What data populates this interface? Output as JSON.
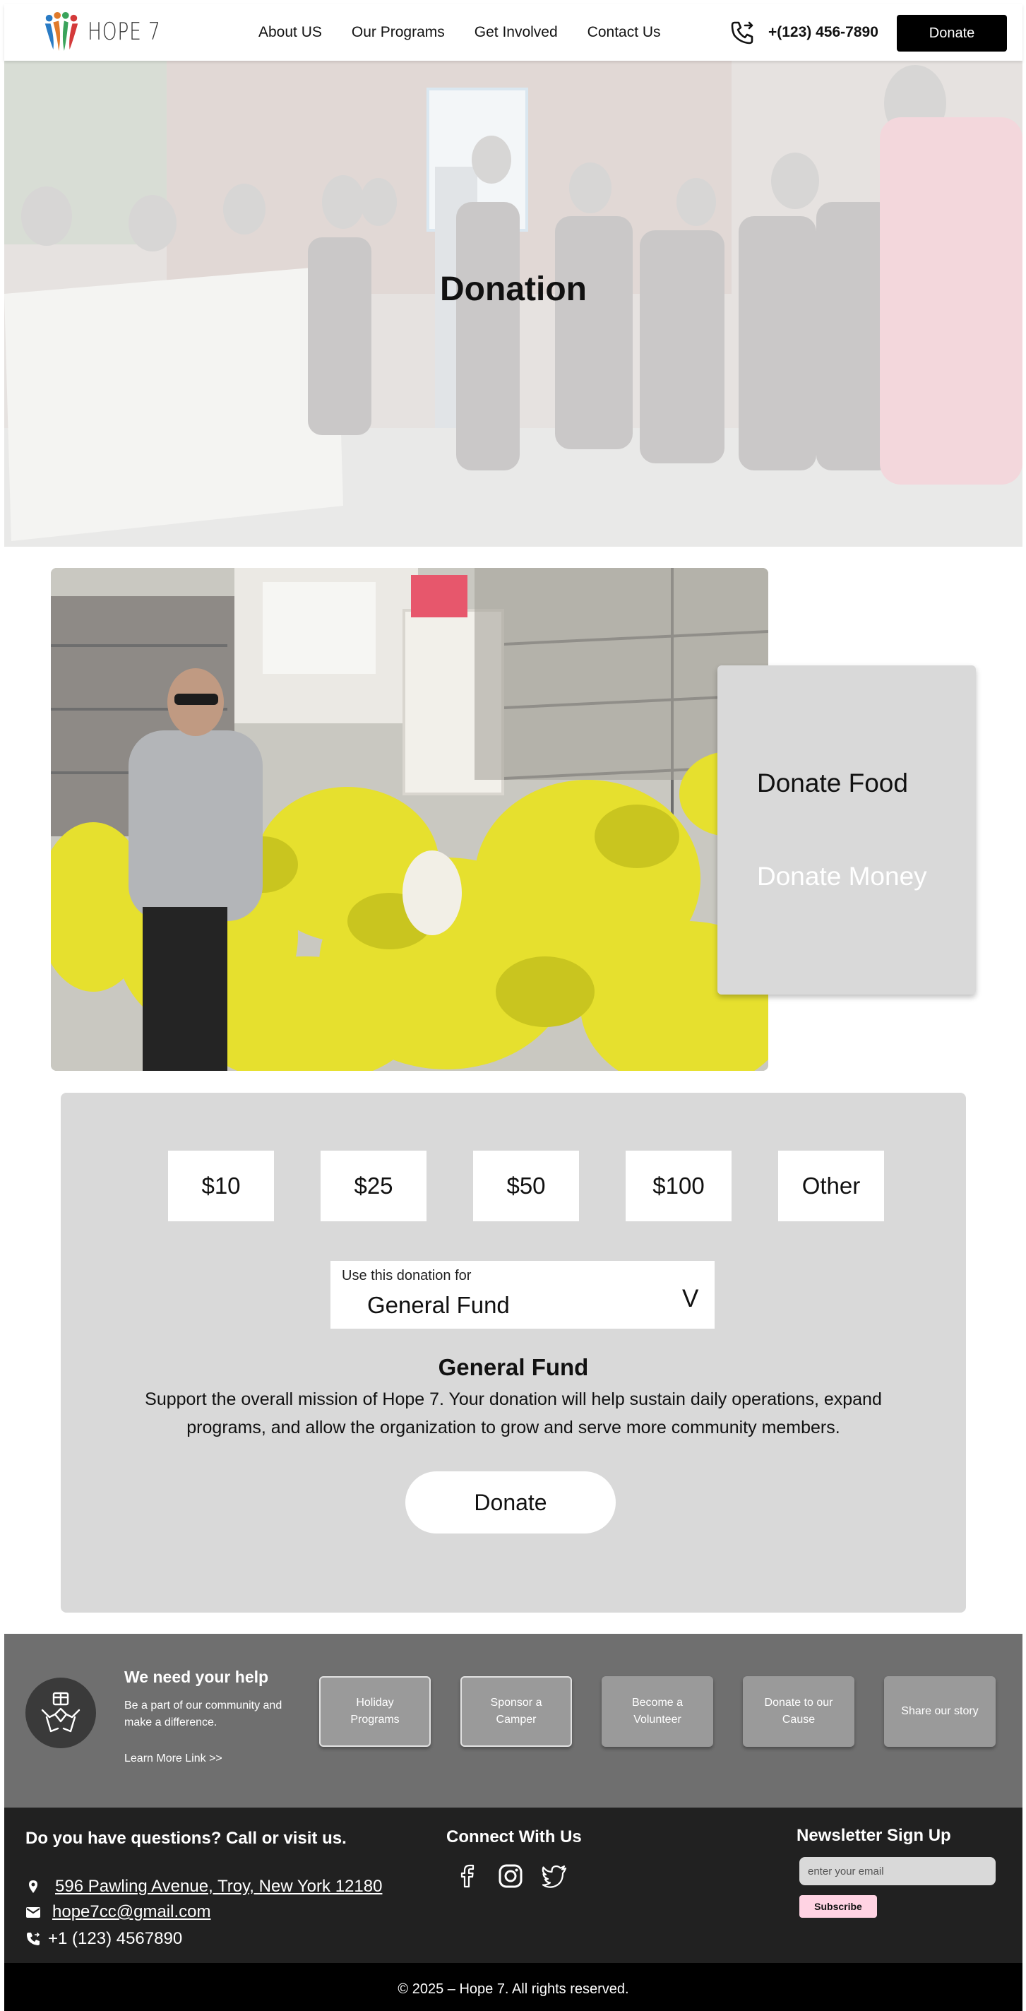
{
  "header": {
    "logo_text": "HOPE 7",
    "nav": [
      "About US",
      "Our Programs",
      "Get Involved",
      "Contact Us"
    ],
    "phone": "+(123) 456-7890",
    "donate_label": "Donate"
  },
  "hero": {
    "title": "Donation"
  },
  "donation_types": {
    "food": "Donate Food",
    "money": "Donate Money"
  },
  "donation_form": {
    "amounts": [
      "$10",
      "$25",
      "$50",
      "$100",
      "Other"
    ],
    "select_label": "Use this donation for",
    "select_value": "General Fund",
    "select_caret": "V",
    "fund_title": "General Fund",
    "fund_description": "Support the overall mission of Hope 7. Your donation will help sustain daily operations, expand programs, and allow the organization to grow and serve more community members.",
    "donate_label": "Donate"
  },
  "help": {
    "title": "We need your help",
    "subtitle": "Be a part of our community and make a difference.",
    "link": "Learn More Link >>",
    "buttons": [
      "Holiday Programs",
      "Sponsor a Camper",
      "Become a Volunteer",
      "Donate to our Cause",
      "Share our story"
    ]
  },
  "footer": {
    "question": "Do you have questions? Call or visit us.",
    "address": "596 Pawling Avenue, Troy, New York 12180",
    "email": "hope7cc@gmail.com",
    "phone": "+1 (123) 4567890",
    "connect_title": "Connect With Us",
    "newsletter_title": "Newsletter Sign Up",
    "email_placeholder": "enter your email",
    "subscribe_label": "Subscribe"
  },
  "copyright": "© 2025 – Hope 7. All rights reserved.",
  "colors": {
    "panel_gray": "#d9d9d9",
    "help_band": "#6f6f6f",
    "footer_bg": "#212121",
    "subscribe_pink": "#ffd3e3"
  }
}
